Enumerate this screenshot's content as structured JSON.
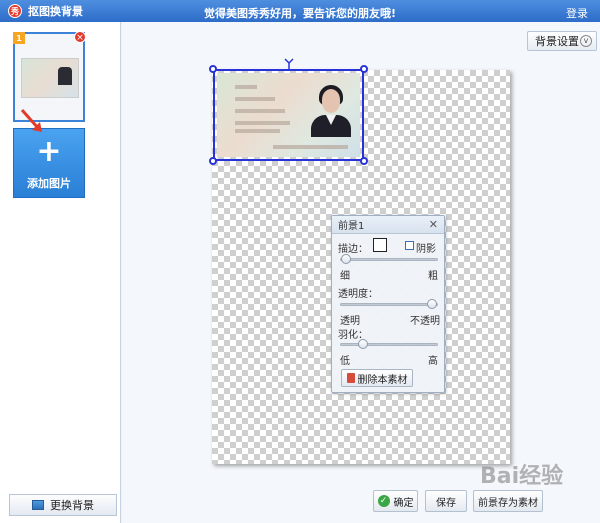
{
  "titlebar": {
    "app_name": "抠图换背景",
    "center_text": "觉得美图秀秀好用，要告诉您的朋友哦!",
    "login": "登录",
    "logo_glyph": "秀"
  },
  "left": {
    "thumbnail_index": "1",
    "thumbnail_close": "×",
    "add_plus": "+",
    "add_label": "添加图片",
    "change_bg_label": "更换背景"
  },
  "toolbar": {
    "bg_settings_label": "背景设置",
    "bg_settings_chevron": "v"
  },
  "dialog": {
    "title": "前景1",
    "close": "✕",
    "stroke_label": "描边：",
    "shadow_label": "阴影",
    "stroke_min": "细",
    "stroke_max": "粗",
    "stroke_value": 0.0,
    "opacity_label": "透明度：",
    "opacity_min": "透明",
    "opacity_max": "不透明",
    "opacity_value": 1.0,
    "feather_label": "羽化：",
    "feather_min": "低",
    "feather_max": "高",
    "feather_value": 0.2,
    "delete_label": "删除本素材"
  },
  "bottom": {
    "ok_label": "确定",
    "save_label": "保存",
    "save_as_material_label": "前景存为素材"
  },
  "watermark": "Bai经验",
  "colors": {
    "title_bar": "#2d6cc8",
    "selection": "#2733d9",
    "add_button": "#2a7fd6"
  }
}
